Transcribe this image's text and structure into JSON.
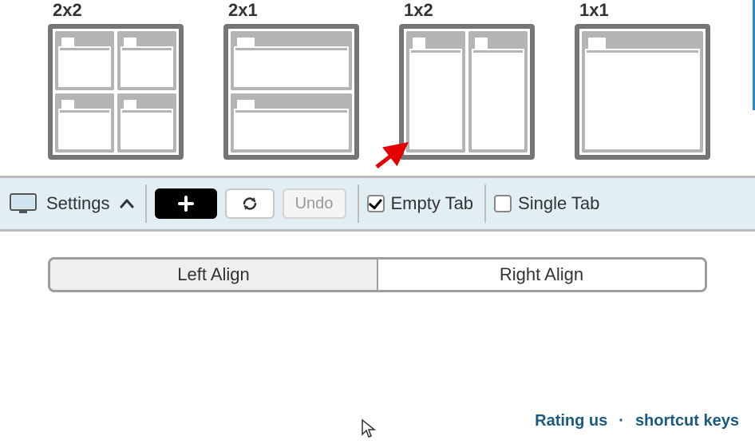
{
  "layouts": [
    {
      "label": "2x2"
    },
    {
      "label": "2x1"
    },
    {
      "label": "1x2"
    },
    {
      "label": "1x1"
    }
  ],
  "toolbar": {
    "settings_label": "Settings",
    "undo_label": "Undo",
    "empty_tab_label": "Empty Tab",
    "single_tab_label": "Single Tab",
    "empty_tab_checked": true,
    "single_tab_checked": false
  },
  "align": {
    "left_label": "Left Align",
    "right_label": "Right Align",
    "active": "left"
  },
  "footer": {
    "rating_label": "Rating us",
    "shortcut_label": "shortcut keys"
  }
}
